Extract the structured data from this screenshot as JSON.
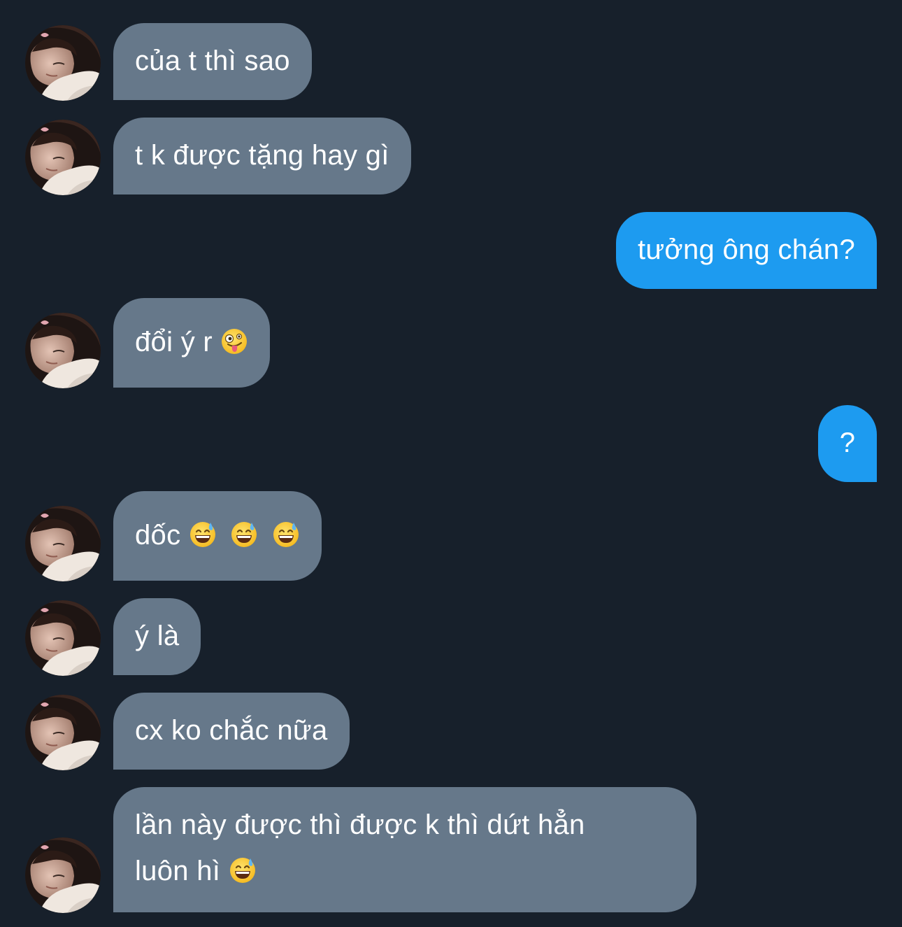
{
  "conversation": {
    "messages": [
      {
        "sender": "them",
        "text": "của t thì sao",
        "emojis": []
      },
      {
        "sender": "them",
        "text": "t k được tặng hay gì",
        "emojis": []
      },
      {
        "sender": "me",
        "text": "tưởng ông chán?",
        "emojis": []
      },
      {
        "sender": "them",
        "text": "đổi ý r",
        "emojis": [
          "zany-face-icon"
        ]
      },
      {
        "sender": "me",
        "text": "?",
        "emojis": []
      },
      {
        "sender": "them",
        "text": "dốc",
        "emojis": [
          "grinning-sweat-icon",
          "grinning-sweat-icon",
          "grinning-sweat-icon"
        ]
      },
      {
        "sender": "them",
        "text": "ý là",
        "emojis": []
      },
      {
        "sender": "them",
        "text": "cx ko chắc nữa",
        "emojis": []
      },
      {
        "sender": "them",
        "line1": "lần này được thì được k thì dứt hẳn",
        "line2": "luôn hì",
        "emojis": [
          "grinning-sweat-icon"
        ]
      }
    ]
  },
  "colors": {
    "background": "#17202b",
    "incoming_bubble": "#66788a",
    "outgoing_bubble": "#1d9bf0",
    "text": "#ffffff"
  }
}
